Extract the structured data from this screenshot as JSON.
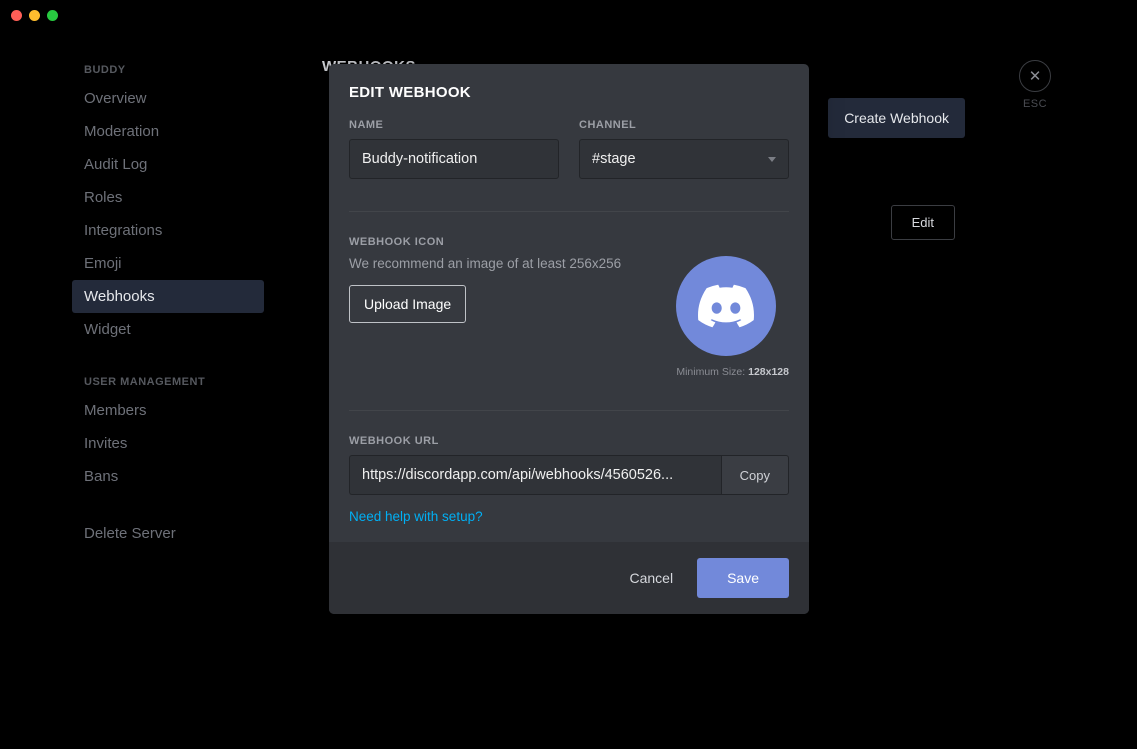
{
  "sidebar": {
    "section1": "BUDDY",
    "items1": [
      "Overview",
      "Moderation",
      "Audit Log",
      "Roles",
      "Integrations",
      "Emoji",
      "Webhooks",
      "Widget"
    ],
    "active_index": 6,
    "section2": "USER MANAGEMENT",
    "items2": [
      "Members",
      "Invites",
      "Bans"
    ],
    "delete_server": "Delete Server"
  },
  "header": {
    "title": "WEBHOOKS",
    "create_button": "Create Webhook",
    "edit_button": "Edit"
  },
  "esc": {
    "label": "ESC"
  },
  "modal": {
    "title": "EDIT WEBHOOK",
    "name_label": "NAME",
    "name_value": "Buddy-notification",
    "channel_label": "CHANNEL",
    "channel_value": "#stage",
    "icon_label": "WEBHOOK ICON",
    "icon_hint": "We recommend an image of at least 256x256",
    "upload_button": "Upload Image",
    "min_size_prefix": "Minimum Size: ",
    "min_size_value": "128x128",
    "url_label": "WEBHOOK URL",
    "url_value": "https://discordapp.com/api/webhooks/4560526...",
    "copy_button": "Copy",
    "help_link": "Need help with setup?",
    "cancel_button": "Cancel",
    "save_button": "Save"
  },
  "colors": {
    "accent": "#7289da",
    "link": "#00aff4",
    "modal_bg": "#36393f"
  }
}
